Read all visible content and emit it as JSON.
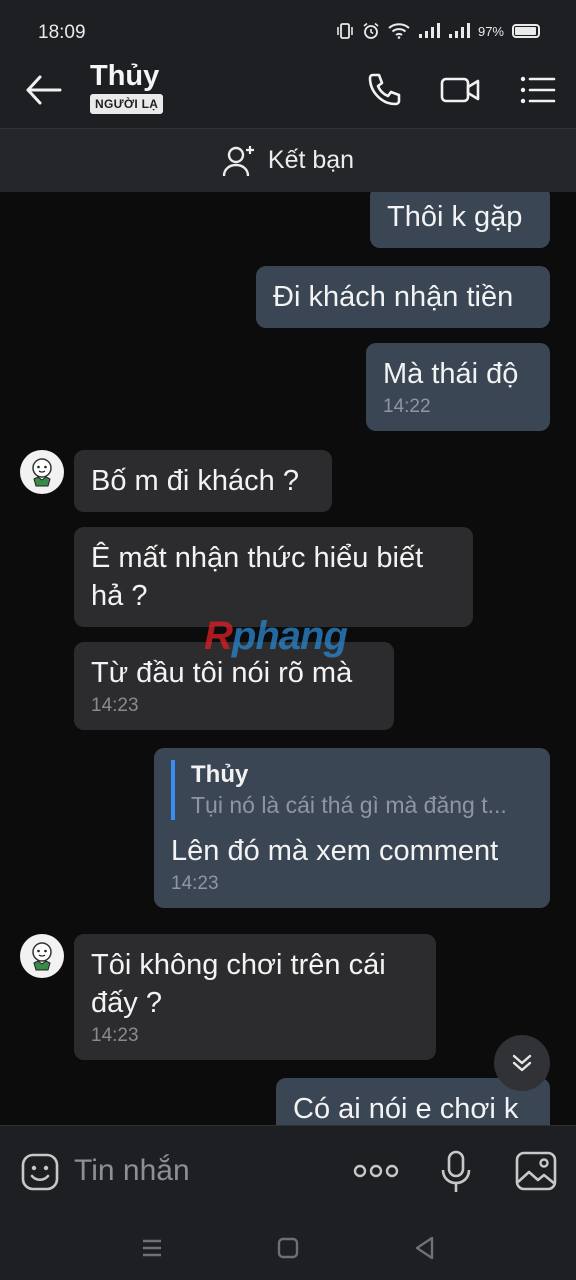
{
  "status_bar": {
    "time": "18:09",
    "battery": "97%"
  },
  "header": {
    "contact_name": "Thủy",
    "badge": "NGƯỜI LẠ"
  },
  "add_friend": {
    "label": "Kết bạn"
  },
  "messages": [
    {
      "text": "Thôi k gặp"
    },
    {
      "text": "Đi khách nhận tiền"
    },
    {
      "text": "Mà thái độ",
      "time": "14:22"
    },
    {
      "text": "Bố m đi khách ?"
    },
    {
      "text": "Ê mất nhận thức hiểu biết hả ?"
    },
    {
      "text": "Từ đầu tôi nói rõ mà",
      "time": "14:23"
    },
    {
      "reply_name": "Thủy",
      "reply_text": "Tụi nó là cái thá gì mà đăng t...",
      "text": "Lên đó mà xem comment",
      "time": "14:23"
    },
    {
      "text": "Tôi không chơi trên cái đấy ?",
      "time": "14:23"
    },
    {
      "text": "Có ai nói e chơi k"
    }
  ],
  "watermark": {
    "part1": "R",
    "part2": "phang"
  },
  "input": {
    "placeholder": "Tin nhắn"
  },
  "colors": {
    "outgoing_bubble": "#3b4655",
    "incoming_bubble": "#2c2c2e",
    "background": "#0c0c0d",
    "reply_accent": "#3b8cf0"
  }
}
